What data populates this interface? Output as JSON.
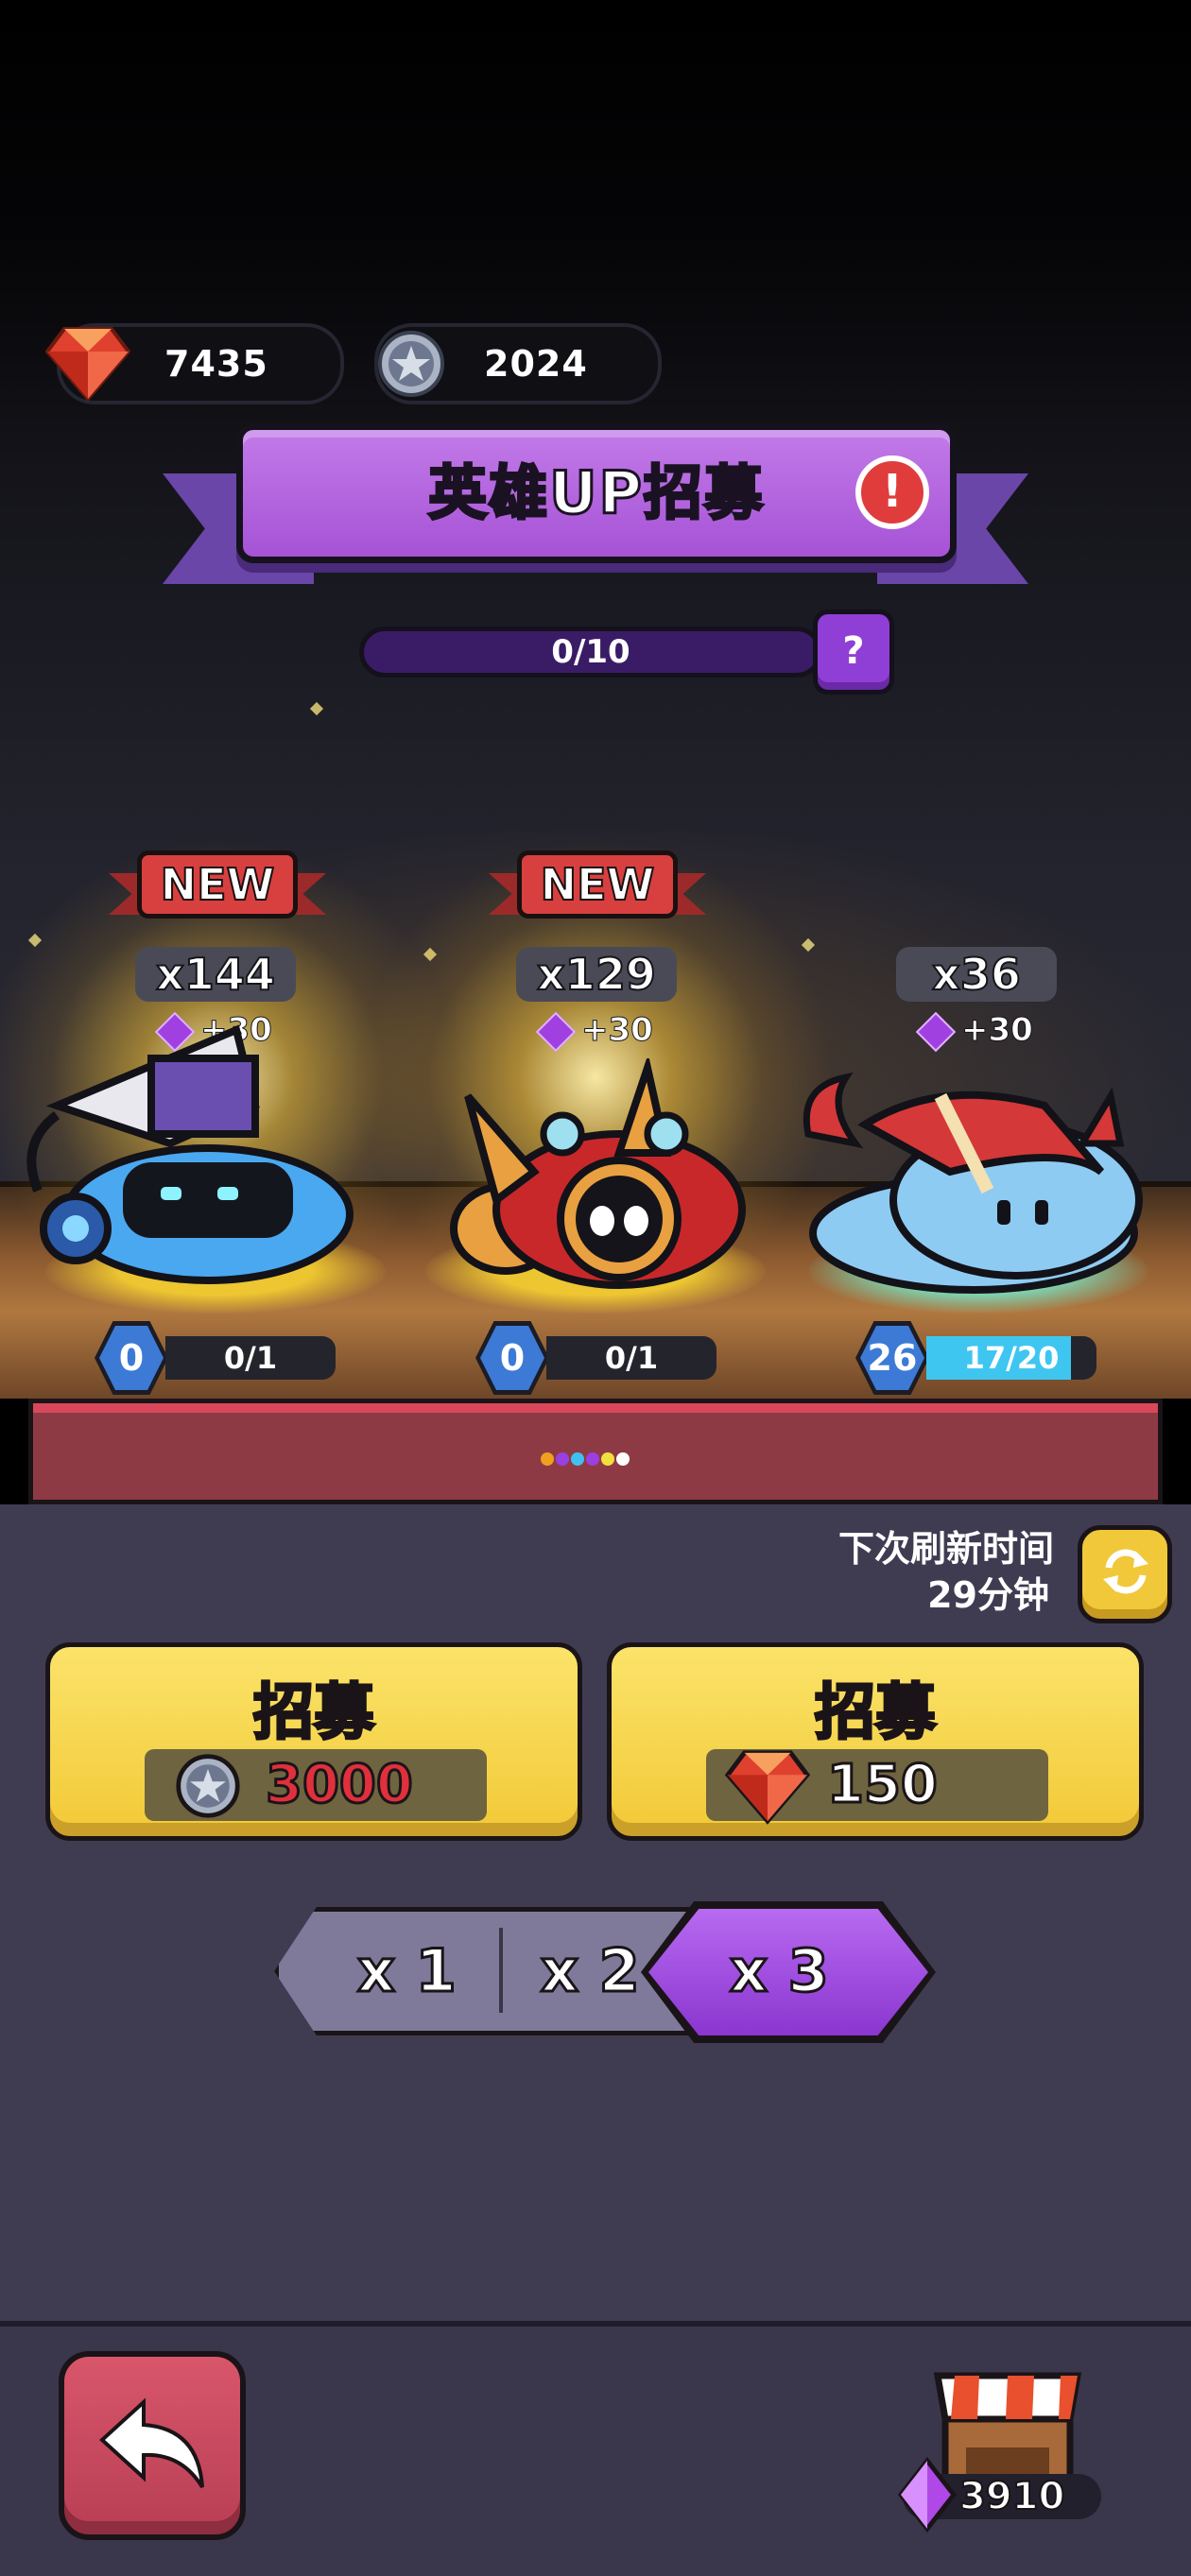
{
  "currencies": {
    "ruby": {
      "value": "7435",
      "icon": "ruby-gem-icon"
    },
    "coin": {
      "value": "2024",
      "icon": "silver-star-coin-icon"
    }
  },
  "banner": {
    "title": "英雄UP招募",
    "info_icon": "!"
  },
  "progress": {
    "text": "0/10",
    "fraction": 0.0,
    "help_icon": "?"
  },
  "heroes": [
    {
      "badge": "NEW",
      "count": "x144",
      "bonus": "+30",
      "level": "0",
      "shards": "0/1",
      "shard_fraction": 0.0,
      "glow": "#f5d030"
    },
    {
      "badge": "NEW",
      "count": "x129",
      "bonus": "+30",
      "level": "0",
      "shards": "0/1",
      "shard_fraction": 0.0,
      "glow": "#f5d030"
    },
    {
      "badge": "",
      "count": "x36",
      "bonus": "+30",
      "level": "26",
      "shards": "17/20",
      "shard_fraction": 0.85,
      "glow": "#7ae0c0"
    }
  ],
  "page_dots": [
    "#f0a020",
    "#9a40e0",
    "#40c0f0",
    "#9a40e0",
    "#f0e040",
    "#ffffff"
  ],
  "refresh": {
    "label": "下次刷新时间",
    "time": "29分钟"
  },
  "recruit": [
    {
      "label": "招募",
      "price": "3000",
      "currency": "silver-star-coin-icon",
      "price_color": "#e0303c"
    },
    {
      "label": "招募",
      "price": "150",
      "currency": "ruby-gem-icon",
      "price_color": "#ffffff"
    }
  ],
  "multipliers": {
    "options": [
      "x 1",
      "x 2",
      "x 3"
    ],
    "selected": "x 3"
  },
  "bottom": {
    "gem_balance": "3910"
  },
  "colors": {
    "accent_purple": "#a653d6",
    "gold": "#f2c936",
    "back_red": "#c84a5e",
    "panel": "#3f3c52"
  }
}
